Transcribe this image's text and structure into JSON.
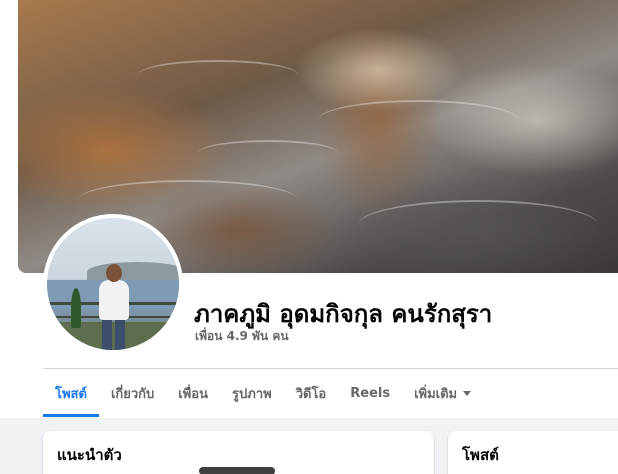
{
  "profile": {
    "name": "ภาคภูมิ อุดมกิจกุล คนรักสุรา",
    "friends_count": "เพื่อน 4.9 พัน คน"
  },
  "tabs": [
    {
      "label": "โพสต์",
      "active": true
    },
    {
      "label": "เกี่ยวกับ",
      "active": false
    },
    {
      "label": "เพื่อน",
      "active": false
    },
    {
      "label": "รูปภาพ",
      "active": false
    },
    {
      "label": "วิดีโอ",
      "active": false
    },
    {
      "label": "Reels",
      "active": false
    },
    {
      "label": "เพิ่มเติม",
      "active": false
    }
  ],
  "cards": {
    "intro_title": "แนะนำตัว",
    "posts_title": "โพสต์"
  },
  "colors": {
    "accent": "#1877f2",
    "text_primary": "#050505",
    "text_secondary": "#65676b",
    "background": "#f0f2f5"
  },
  "icons": {
    "more_tab": "caret-down-icon"
  }
}
